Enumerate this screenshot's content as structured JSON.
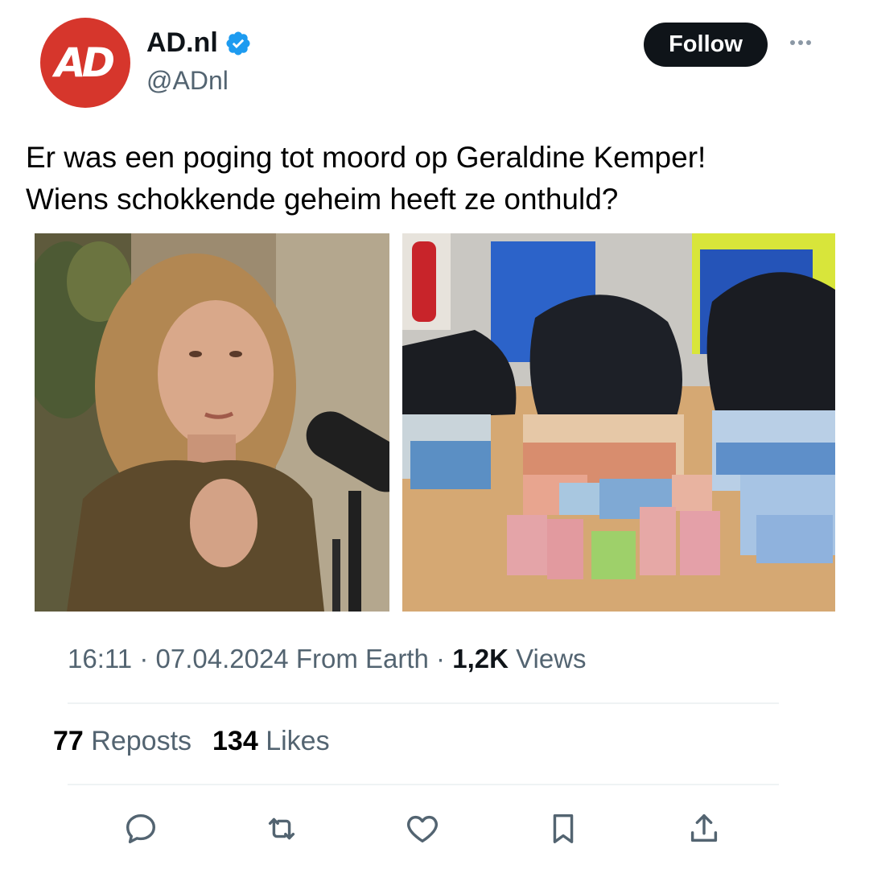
{
  "author": {
    "avatar_text": "AD",
    "display_name": "AD.nl",
    "handle": "@ADnl",
    "verified": true,
    "brand_color": "#d6362c"
  },
  "follow_label": "Follow",
  "more_icon": "ellipsis-icon",
  "tweet": {
    "lines": [
      "Er was een poging tot moord op Geraldine Kemper!",
      "Wiens schokkende geheim heeft ze onthuld?"
    ]
  },
  "meta": {
    "time": "16:11",
    "date": "07.04.2024",
    "location": "From Earth",
    "views_count": "1,2K",
    "views_label": "Views"
  },
  "stats": {
    "reposts_count": "77",
    "reposts_label": "Reposts",
    "likes_count": "134",
    "likes_label": "Likes"
  },
  "actions": [
    "reply-icon",
    "repost-icon",
    "like-icon",
    "bookmark-icon",
    "share-icon"
  ],
  "colors": {
    "text": "#0f1419",
    "secondary": "#536471",
    "verified": "#1d9bf0"
  }
}
